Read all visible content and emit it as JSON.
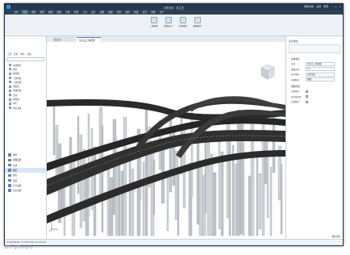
{
  "titlebar": {
    "title": "示例分析 - 某立交",
    "rightbuttons": [
      "帮助文档",
      "设置",
      "登录"
    ]
  },
  "menubar": {
    "items": [
      "文件",
      "开始",
      "视图",
      "选择",
      "编辑",
      "建模",
      "分析",
      "结果",
      "工具",
      "设计",
      "出图",
      "数据",
      "协同",
      "插件",
      "模型",
      "显示",
      "帮助",
      "关于"
    ],
    "active_index": 1
  },
  "ribbon": {
    "tools": [
      {
        "label": "三维视图",
        "icon": "view-3d-icon"
      },
      {
        "label": "视图方向",
        "icon": "orientation-icon"
      },
      {
        "label": "全景视图",
        "icon": "panorama-icon"
      },
      {
        "label": "视图设置",
        "icon": "view-settings-icon"
      }
    ]
  },
  "viewtabs": [
    {
      "label": "某立交"
    },
    {
      "label": "某立交三维视图"
    }
  ],
  "leftpanel": {
    "tabs": [
      "工程",
      "结构",
      "构件",
      "荷载"
    ],
    "tree_items": [
      "项目概况",
      "墩台",
      "桩基础",
      "上部结构",
      "下部结构",
      "桥面系",
      "附属结构",
      "支座",
      "伸缩缝",
      "护栏",
      "排水系统"
    ],
    "bottom_items": [
      {
        "label": "构件",
        "selected": false
      },
      {
        "label": "视图设置",
        "selected": false
      },
      {
        "label": "过滤",
        "selected": false
      },
      {
        "label": "图层",
        "selected": true
      },
      {
        "label": "颜色",
        "selected": false
      },
      {
        "label": "材质",
        "selected": false
      },
      {
        "label": "灯光设置",
        "selected": false
      },
      {
        "label": "显示设置",
        "selected": false
      }
    ]
  },
  "rightpanel": {
    "title": "显示属性",
    "section1": "基本属性",
    "rows": [
      {
        "key": "名称",
        "value": "某立交三维视图"
      },
      {
        "key": "视图比例",
        "value": "1:1"
      },
      {
        "key": "显示模式",
        "value": "实体渲染"
      },
      {
        "key": "详细程度",
        "value": "精细"
      }
    ],
    "section2": "视图范围",
    "checks": [
      {
        "key": "剖切裁剪"
      },
      {
        "key": "显示裁剪框"
      },
      {
        "key": "注释裁剪"
      }
    ],
    "bottom_button": "属性选项"
  },
  "statusbar": {
    "text": "X=22576.24, Y=72121.60, Z=171.95"
  },
  "watermark": "知乎 @Gongtu",
  "colors": {
    "titlebar": "#25384c",
    "menubar": "#2c4258",
    "accent": "#3a7fc0",
    "deck": "#2a2a2a",
    "pier": "#d0d4d8"
  }
}
